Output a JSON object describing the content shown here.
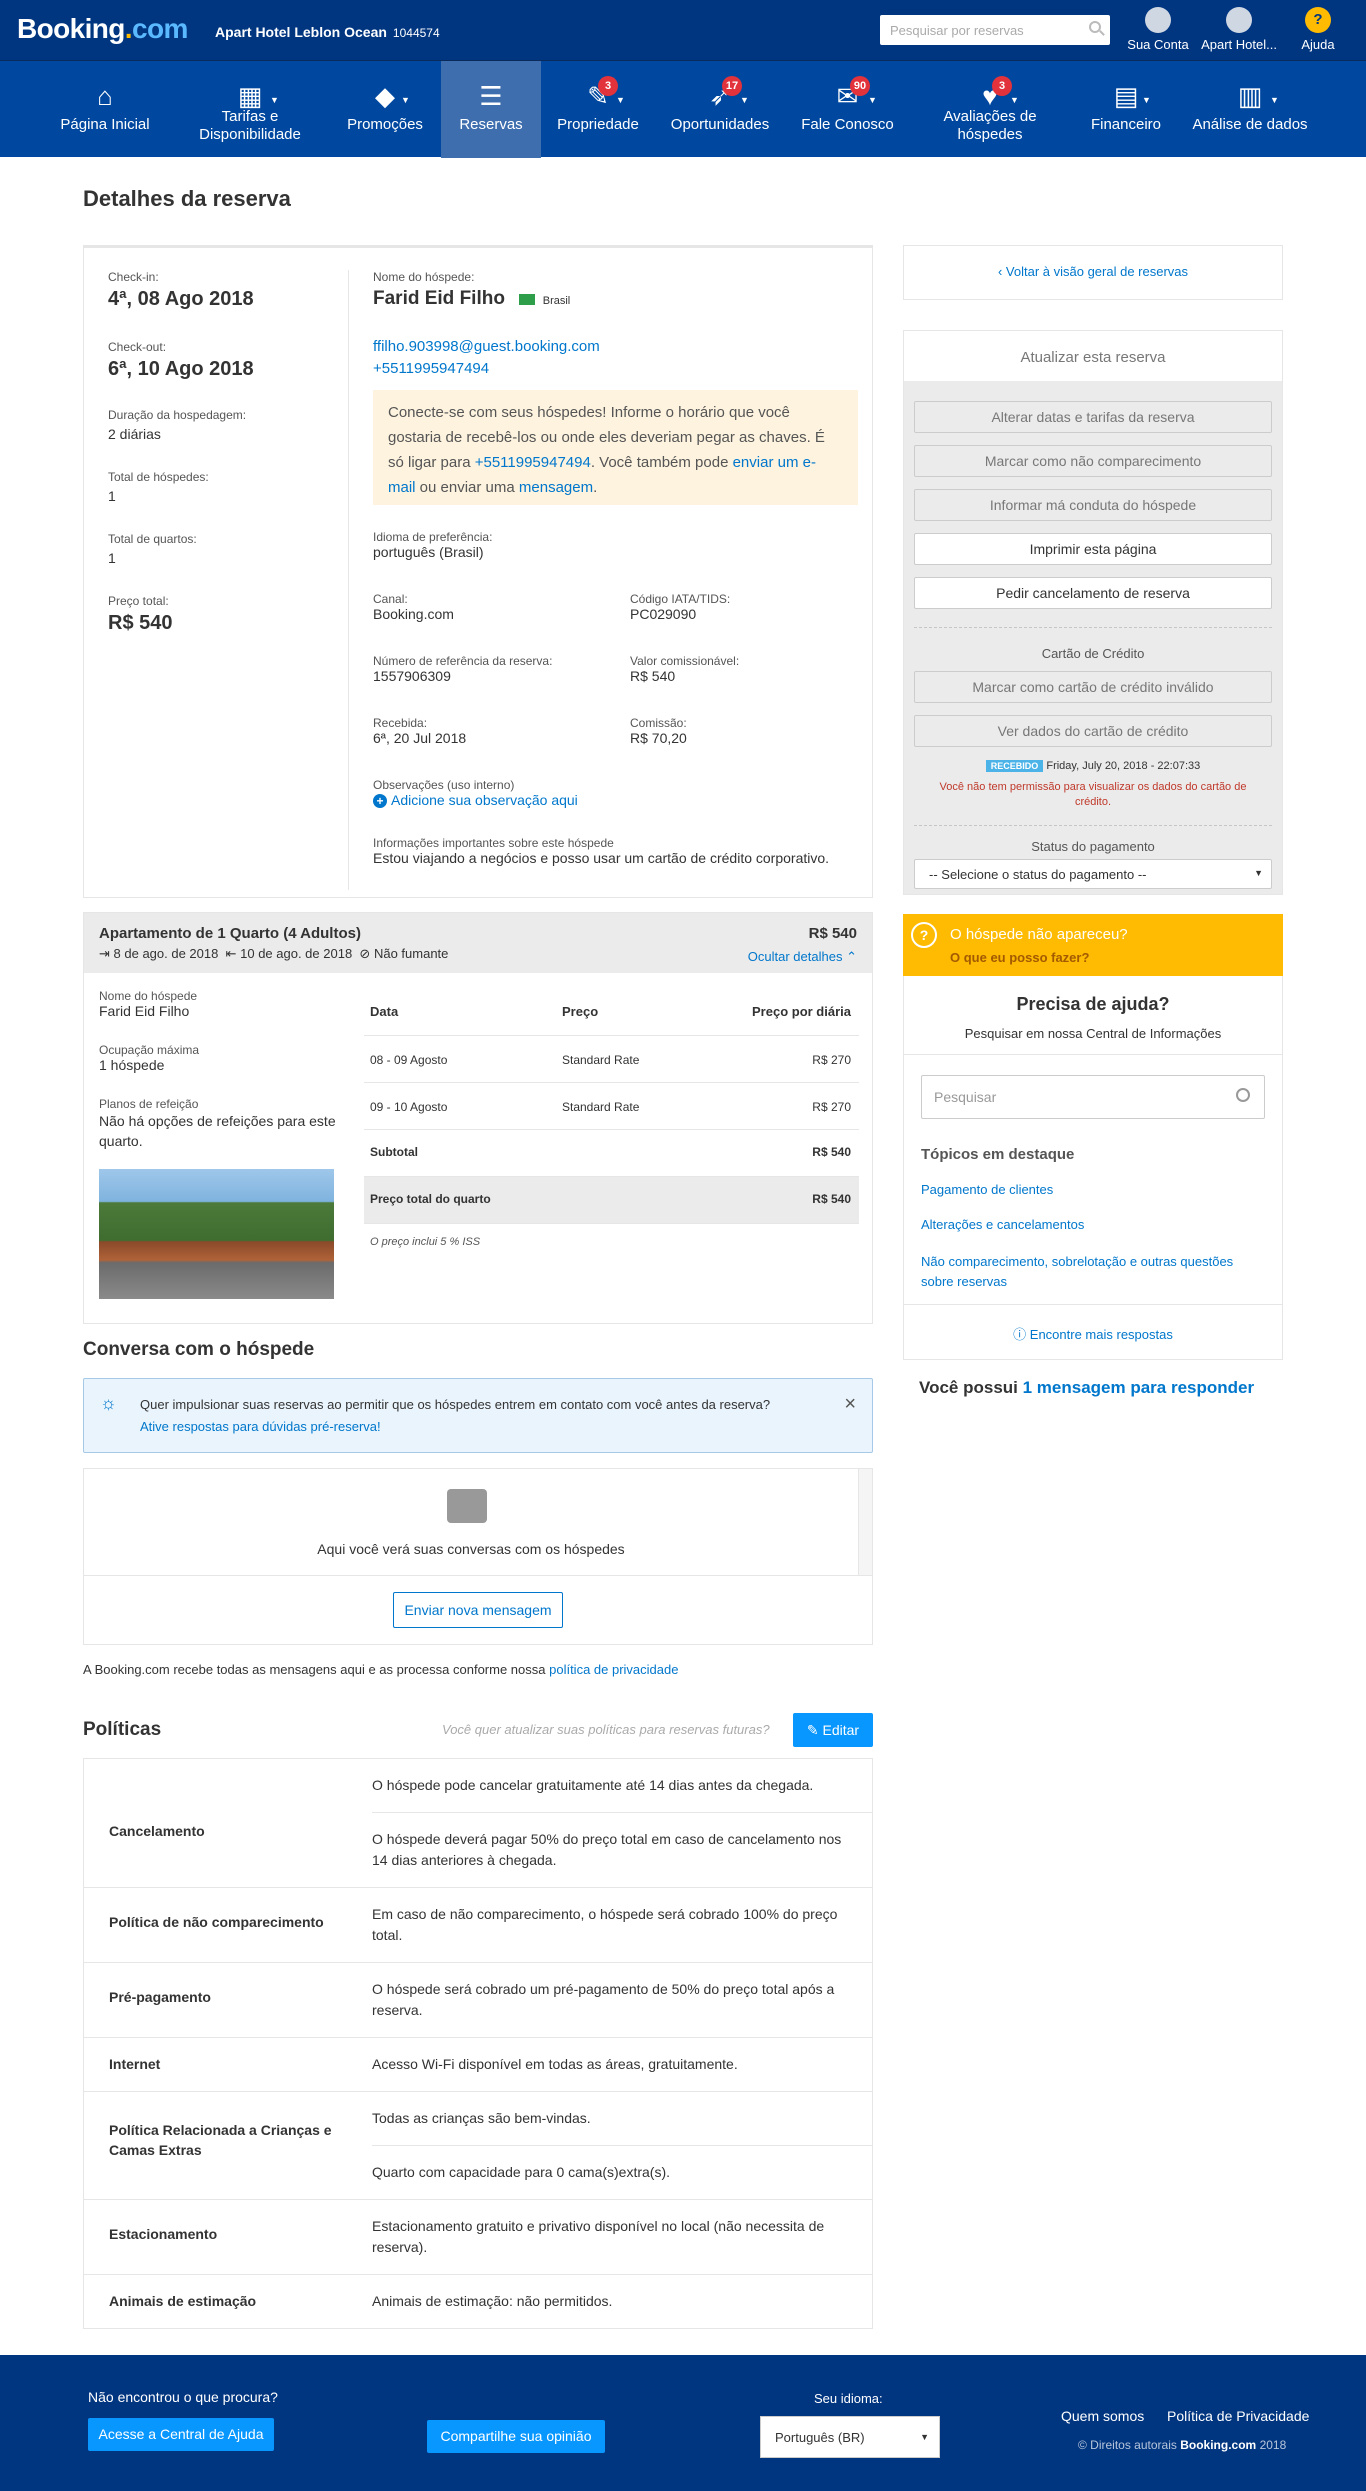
{
  "topbar": {
    "logo_main": "Booking",
    "logo_dot": ".",
    "logo_com": "com",
    "hotel_name": "Apart Hotel Leblon Ocean",
    "hotel_id": "1044574",
    "search_placeholder": "Pesquisar por reservas",
    "account": "Sua Conta",
    "property": "Apart Hotel...",
    "help": "Ajuda"
  },
  "nav": {
    "home": "Página Inicial",
    "rates": "Tarifas e Disponibilidade",
    "promos": "Promoções",
    "reservations": "Reservas",
    "property": "Propriedade",
    "opportunities": "Oportunidades",
    "contact": "Fale Conosco",
    "reviews": "Avaliações de hóspedes",
    "finance": "Financeiro",
    "analytics": "Análise de dados",
    "badge_property": "3",
    "badge_opportunities": "17",
    "badge_contact": "90",
    "badge_reviews": "3"
  },
  "page_title": "Detalhes da reserva",
  "reservation": {
    "checkin_label": "Check-in:",
    "checkin": "4ª, 08 Ago 2018",
    "checkout_label": "Check-out:",
    "checkout": "6ª, 10 Ago 2018",
    "duration_label": "Duração da hospedagem:",
    "duration": "2 diárias",
    "guests_label": "Total de hóspedes:",
    "guests": "1",
    "rooms_label": "Total de quartos:",
    "rooms": "1",
    "price_label": "Preço total:",
    "price": "R$ 540",
    "guest_name_label": "Nome do hóspede:",
    "guest_name": "Farid Eid Filho",
    "country": "Brasil",
    "email": "ffilho.903998@guest.booking.com",
    "phone": "+5511995947494",
    "notice_a": "Conecte-se com seus hóspedes! Informe o horário que você gostaria de recebê-los ou onde eles deveriam pegar as chaves. É só ligar para ",
    "notice_phone": "+5511995947494",
    "notice_b": ". Você também pode ",
    "notice_email": "enviar um e-mail",
    "notice_c": " ou enviar uma ",
    "notice_msg": "mensagem",
    "notice_d": ".",
    "lang_label": "Idioma de preferência:",
    "lang": "português (Brasil)",
    "channel_label": "Canal:",
    "channel": "Booking.com",
    "iata_label": "Código IATA/TIDS:",
    "iata": "PC029090",
    "ref_label": "Número de referência da reserva:",
    "ref": "1557906309",
    "comm_value_label": "Valor comissionável:",
    "comm_value": "R$ 540",
    "received_label": "Recebida:",
    "received": "6ª, 20 Jul 2018",
    "commission_label": "Comissão:",
    "commission": "R$ 70,20",
    "obs_label": "Observações (uso interno)",
    "obs_add": "Adicione sua observação aqui",
    "info_label": "Informações importantes sobre este hóspede",
    "info": "Estou viajando a negócios e posso usar um cartão de crédito corporativo."
  },
  "room": {
    "title": "Apartamento de 1 Quarto (4 Adultos)",
    "price": "R$ 540",
    "from": "8 de ago. de 2018",
    "to": "10 de ago. de 2018",
    "smoking": "Não fumante",
    "hide": "Ocultar detalhes",
    "guest_label": "Nome do hóspede",
    "guest": "Farid Eid Filho",
    "occ_label": "Ocupação máxima",
    "occ": "1 hóspede",
    "meal_label": "Planos de refeição",
    "meal": "Não há opções de refeições para este quarto.",
    "table_headers": {
      "date": "Data",
      "price": "Preço",
      "per_night": "Preço por diária"
    },
    "rows": [
      {
        "date": "08 - 09 Agosto",
        "rate": "Standard Rate",
        "amount": "R$ 270"
      },
      {
        "date": "09 - 10 Agosto",
        "rate": "Standard Rate",
        "amount": "R$ 270"
      }
    ],
    "subtotal_label": "Subtotal",
    "subtotal": "R$ 540",
    "total_label": "Preço total do quarto",
    "total": "R$ 540",
    "tax_note": "O preço inclui 5 % ISS"
  },
  "conversation": {
    "title": "Conversa com o hóspede",
    "banner_text": "Quer impulsionar suas reservas ao permitir que os hóspedes entrem em contato com você antes da reserva?",
    "banner_link": "Ative respostas para dúvidas pré-reserva!",
    "empty": "Aqui você verá suas conversas com os hóspedes",
    "send_button": "Enviar nova mensagem",
    "privacy_text": "A Booking.com recebe todas as mensagens aqui e as processa conforme nossa ",
    "privacy_link": "política de privacidade"
  },
  "policies": {
    "title": "Políticas",
    "prompt": "Você quer atualizar suas políticas para reservas futuras?",
    "edit": "Editar",
    "cancel_name": "Cancelamento",
    "cancel_1": "O hóspede pode cancelar gratuitamente até 14 dias antes da chegada.",
    "cancel_2": "O hóspede deverá pagar 50% do preço total em caso de cancelamento nos 14 dias anteriores à chegada.",
    "noshow_name": "Política de não comparecimento",
    "noshow": "Em caso de não comparecimento, o hóspede será cobrado 100% do preço total.",
    "prepay_name": "Pré-pagamento",
    "prepay": "O hóspede será cobrado um pré-pagamento de 50% do preço total após a reserva.",
    "internet_name": "Internet",
    "internet": "Acesso Wi-Fi disponível em todas as áreas, gratuitamente.",
    "kids_name": "Política Relacionada a Crianças e Camas Extras",
    "kids_1": "Todas as crianças são bem-vindas.",
    "kids_2": "Quarto com capacidade para 0 cama(s)extra(s).",
    "parking_name": "Estacionamento",
    "parking": "Estacionamento gratuito e privativo disponível no local (não necessita de reserva).",
    "pets_name": "Animais de estimação",
    "pets": "Animais de estimação: não permitidos."
  },
  "sidebar": {
    "back": "Voltar à visão geral de reservas",
    "update_title": "Atualizar esta reserva",
    "btn_dates": "Alterar datas e tarifas da reserva",
    "btn_noshow": "Marcar como não comparecimento",
    "btn_misconduct": "Informar má conduta do hóspede",
    "btn_print": "Imprimir esta página",
    "btn_cancel": "Pedir cancelamento de reserva",
    "cc_title": "Cartão de Crédito",
    "btn_invalid": "Marcar como cartão de crédito inválido",
    "btn_view_cc": "Ver dados do cartão de crédito",
    "received_badge": "RECEBIDO",
    "received_date": "Friday, July 20, 2018 - 22:07:33",
    "cc_error": "Você não tem permissão para visualizar os dados do cartão de crédito.",
    "payment_label": "Status do pagamento",
    "payment_select": "-- Selecione o status do pagamento --",
    "noshow_q": "O hóspede não apareceu?",
    "noshow_do": "O que eu posso fazer?",
    "help_title": "Precisa de ajuda?",
    "help_sub": "Pesquisar em nossa Central de Informações",
    "help_search": "Pesquisar",
    "topics": "Tópicos em destaque",
    "topic_1": "Pagamento de clientes",
    "topic_2": "Alterações e cancelamentos",
    "topic_3": "Não comparecimento, sobrelotação e outras questões sobre reservas",
    "more": "Encontre mais respostas",
    "msg_a": "Você possui ",
    "msg_b": "1 mensagem para responder"
  },
  "footer": {
    "q": "Não encontrou o que procura?",
    "help_btn": "Acesse a Central de Ajuda",
    "share_btn": "Compartilhe sua opinião",
    "lang_label": "Seu idioma:",
    "lang_value": "Português (BR)",
    "about": "Quem somos",
    "privacy": "Política de Privacidade",
    "copy_a": "© Direitos autorais ",
    "copy_brand": "Booking.com",
    "copy_year": " 2018"
  },
  "colors": {
    "brand_dark": "#003580",
    "nav": "#00489f",
    "nav_active": "#3e6eae",
    "accent": "#0077cc",
    "yellow": "#febb02",
    "badge": "#e2323b"
  }
}
